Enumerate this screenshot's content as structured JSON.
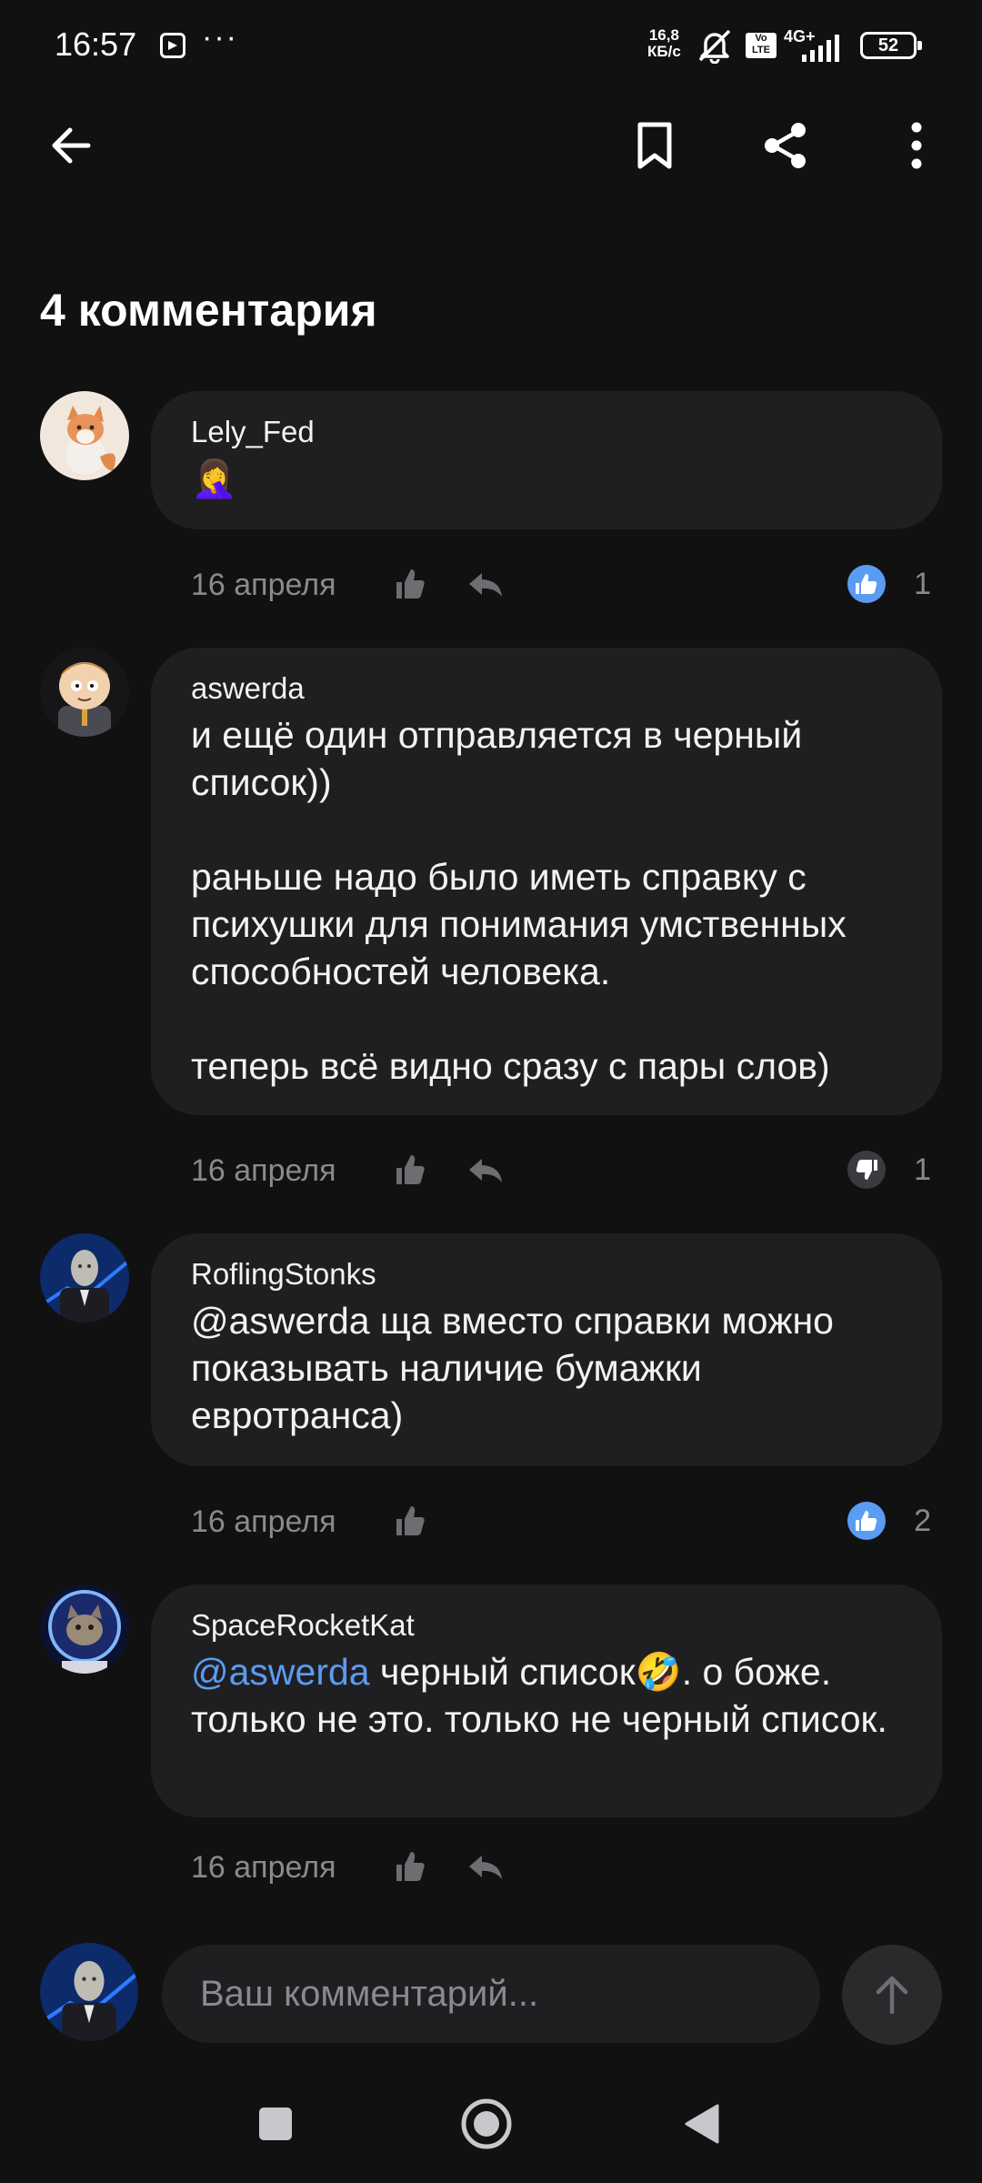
{
  "status_bar": {
    "time": "16:57",
    "net_speed_value": "16,8",
    "net_speed_unit": "КБ/с",
    "volte": "Vo LTE",
    "network": "4G+",
    "battery": "52"
  },
  "header": {
    "back_icon": "arrow-left-icon",
    "bookmark_icon": "bookmark-icon",
    "share_icon": "share-icon",
    "more_icon": "more-vertical-icon"
  },
  "heading": "4 комментария",
  "comments": [
    {
      "author": "Lely_Fed",
      "text": "🤦‍♀️",
      "date": "16 апреля",
      "reaction": "like",
      "score": "1"
    },
    {
      "author": "aswerda",
      "text": "и ещё один отправляется в черный список))\n\nраньше надо было иметь справку с психушки для понимания умственных способностей человека.\n\nтеперь всё видно сразу с пары слов)",
      "date": "16 апреля",
      "reaction": "dislike",
      "score": "1"
    },
    {
      "author": "RoflingStonks",
      "text": "@aswerda ща вместо справки можно показывать наличие бумажки евротранса)",
      "date": "16 апреля",
      "reaction": "like",
      "score": "2"
    },
    {
      "author": "SpaceRocketKat",
      "mention": "@aswerda",
      "text": " черный список🤣. о боже. только не это. только не черный список.",
      "date": "16 апреля"
    }
  ],
  "composer": {
    "placeholder": "Ваш комментарий..."
  },
  "colors": {
    "background": "#111112",
    "bubble": "#1f1f21",
    "accent": "#5a9cf2",
    "muted": "#8a8a8e"
  }
}
